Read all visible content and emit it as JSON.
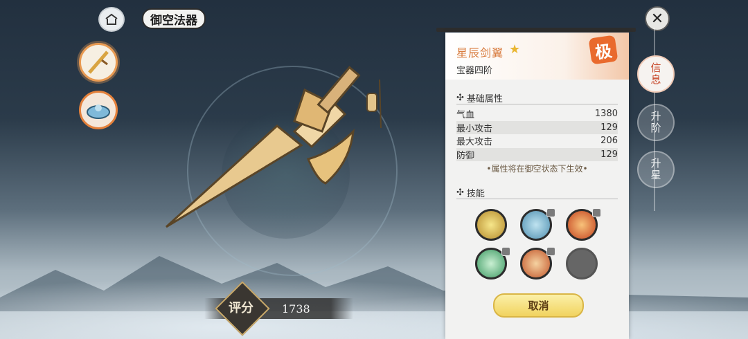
{
  "header": {
    "title": "御空法器",
    "close_icon": "close-icon"
  },
  "weapon_slots": [
    "golden-sword-icon",
    "blue-vehicle-icon"
  ],
  "score": {
    "badge": "评分",
    "value": "1738"
  },
  "item": {
    "name": "星辰剑翼",
    "grade": "宝器四阶",
    "seal": "极"
  },
  "attributes": {
    "section_title": "基础属性",
    "rows": [
      {
        "label": "气血",
        "value": "1380"
      },
      {
        "label": "最小攻击",
        "value": "129"
      },
      {
        "label": "最大攻击",
        "value": "206"
      },
      {
        "label": "防御",
        "value": "129"
      }
    ],
    "note": "•属性将在御空状态下生效•"
  },
  "skills": {
    "section_title": "技能"
  },
  "buttons": {
    "cancel": "取消"
  },
  "side_tabs": [
    {
      "label": "信息",
      "active": true
    },
    {
      "label": "升阶",
      "active": false
    },
    {
      "label": "升星",
      "active": false
    }
  ],
  "colors": {
    "accent": "#d87a3c",
    "seal": "#e96a2d",
    "button": "#f1d35f"
  }
}
